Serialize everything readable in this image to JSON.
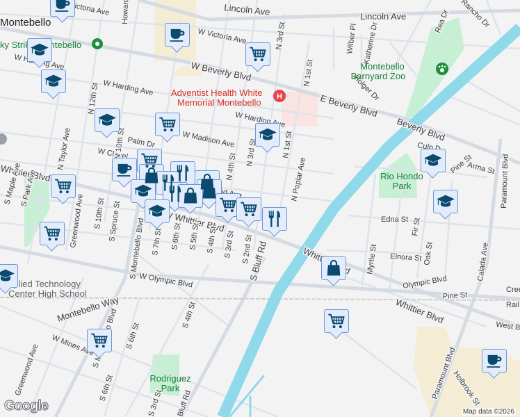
{
  "labels": {
    "city": "Montebello",
    "lincoln_ave": "Lincoln Ave",
    "lincoln_ave_2": "Lincoln Ave",
    "w_victoria_ave": "W Victoria Ave",
    "victoria_ave_left": "Victoria Ave",
    "w_beverly_blvd": "W Beverly Blvd",
    "e_beverly_blvd": "E Beverly Blvd",
    "beverly_blvd": "Beverly Blvd",
    "w_harding_ave": "W Harding Ave",
    "w_harding_ave_left": "W Harding Ave",
    "w_harding_ave_right": "W Harding Ave",
    "madison_ave": "W Madison Ave",
    "palm_dr": "Palm Dr",
    "w_cleveland": "W Clevel",
    "whittier_blvd_left": "Whittier Blvd",
    "w_whittier_blvd": "W Whittier Blvd",
    "whittier_blvd": "Whittier Blvd",
    "whittier_blvd_right": "Whittier Blvd",
    "n_12th_st": "N 12th St",
    "n_10th_st": "N 10th St",
    "n_taylor_ave": "N Taylor Ave",
    "n_4th_st": "N 4th St",
    "n_3rd_st": "N 3rd St",
    "n_3rd_st_top": "N 3rd St",
    "n_1st_st": "N 1st St",
    "n_1st_st_top": "N 1st St",
    "n_poplar_ave": "N Poplar Ave",
    "wilber_pl": "Wilber Pl",
    "katherine_dr": "Katherine Dr",
    "holger_dr": "Holger Dr",
    "rea_dr": "Rea Dr",
    "rancho_dr": "Rancho Dr",
    "howard": "Howard",
    "s_maple_ave": "S Maple Ave",
    "s_park_ave": "S Park Ave",
    "greenwood_ave": "Greenwood Ave",
    "greenwood_ave_s": "Greenwood Ave",
    "s_10th_st": "S 10th St",
    "s_spruce_st": "S Spruce St",
    "s_montebello_blvd": "S Montebello Blvd",
    "s_montebello_blvd_2": "S Montebello Blvd",
    "s_7th_st": "S 7th St",
    "s_6th_st": "S 6th St",
    "s_6th_st_2": "S 6th St",
    "s_6th_st_3": "S 6th St",
    "s_5th_st": "S 5th St",
    "s_4th_st": "S 4th St",
    "s_4th_st_2": "S 4th St",
    "s_3rd_st": "S 3rd St",
    "s_3rd_st_2": "S 3rd St",
    "s_2nd_st": "S 2nd St",
    "s_bluff_rd": "S Bluff Rd",
    "bluff_rd": "Bluff Rd",
    "w_olympic_blvd": "W Olympic Blvd",
    "olympic_blvd": "Olympic Blvd",
    "montebello_way": "Montebello Way",
    "w_mines_ave": "W Mines Ave",
    "edna_st": "Edna St",
    "fir_st": "Fir St",
    "oak_st": "Oak St",
    "myrtle_st": "Myrtle St",
    "elnora_st": "Elnora St",
    "calada_ave": "Calada Ave",
    "pine_st": "Pine St",
    "pine_st_2": "Pine St",
    "arma_st": "Arma St",
    "paramount_blvd": "Paramount Blvd",
    "paramount_blvd_2": "Paramount Blvd",
    "holbrook_st": "Holbrook St",
    "west_blvd": "West Bl",
    "creek": "Cree",
    "rail": "Rail",
    "culp": "Culp D",
    "cleland_ave": "eland Ave"
  },
  "pois": {
    "hospital_line1": "Adventist Health White",
    "hospital_line2": "Memorial Montebello",
    "zoo_line1": "Montebello",
    "zoo_line2": "Barnyard Zoo",
    "rio_hondo_line1": "Rio Hondo",
    "rio_hondo_line2": "Park",
    "rodriguez_line1": "Rodriguez",
    "rodriguez_line2": "Park",
    "lucky_strike": "ky Strike Montebello",
    "school_line1": "pplied Technology",
    "school_line2": "Center High School"
  },
  "footer": {
    "google": "Google",
    "map_data": "Map data ©2026"
  },
  "colors": {
    "marker_fill": "#e3ecfb",
    "marker_border": "#6f95d6",
    "icon": "#0b4a6f",
    "river": "#8fd9ea",
    "park": "#c6efd4"
  }
}
